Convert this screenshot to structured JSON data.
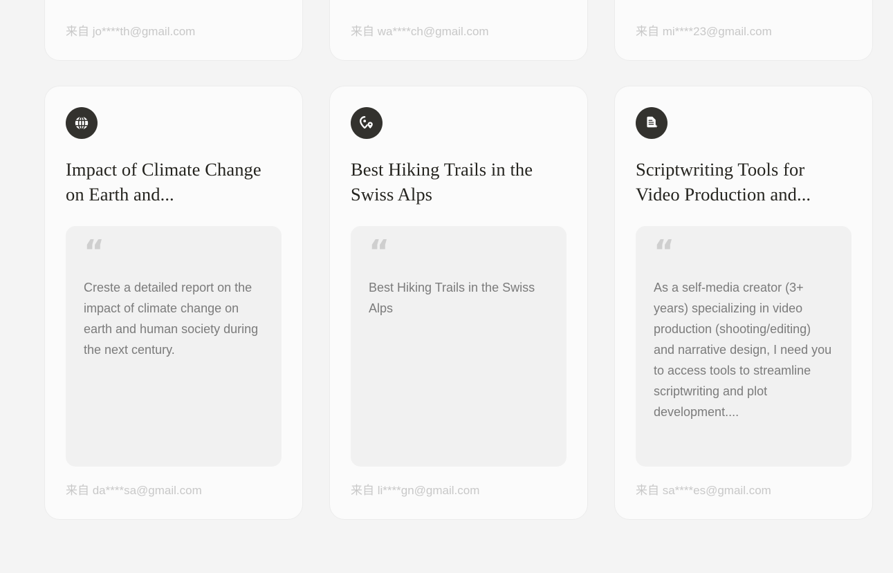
{
  "theme": {
    "page_background": "#f4f4f4",
    "card_background": "#fbfbfb",
    "card_border": "#ececec",
    "quote_background": "#f1f1f1",
    "icon_badge_background": "#33322e",
    "title_color": "#25241f",
    "quote_text_color": "#7b7b7b",
    "attribution_color": "#c8c8c8"
  },
  "cards_row_top": [
    {
      "attribution": "来自 jo****th@gmail.com"
    },
    {
      "attribution": "来自 wa****ch@gmail.com"
    },
    {
      "attribution": "来自 mi****23@gmail.com"
    }
  ],
  "cards_row_bottom": [
    {
      "icon": "globe-icon",
      "title": "Impact of Climate Change on Earth and...",
      "quote_mark": "“",
      "quote": "Creste a detailed report on the impact of climate change on earth and human society during the next century.",
      "attribution": "来自 da****sa@gmail.com"
    },
    {
      "icon": "map-pin-icon",
      "title": "Best Hiking Trails in the Swiss Alps",
      "quote_mark": "“",
      "quote": "Best Hiking Trails in the Swiss Alps",
      "attribution": "来自 li****gn@gmail.com"
    },
    {
      "icon": "document-sparkle-icon",
      "title": "Scriptwriting Tools for Video Production and...",
      "quote_mark": "“",
      "quote": "As a self-media creator (3+ years) specializing in video production (shooting/editing) and narrative design, I need you to access tools to streamline scriptwriting and plot development....",
      "attribution": "来自 sa****es@gmail.com"
    }
  ]
}
